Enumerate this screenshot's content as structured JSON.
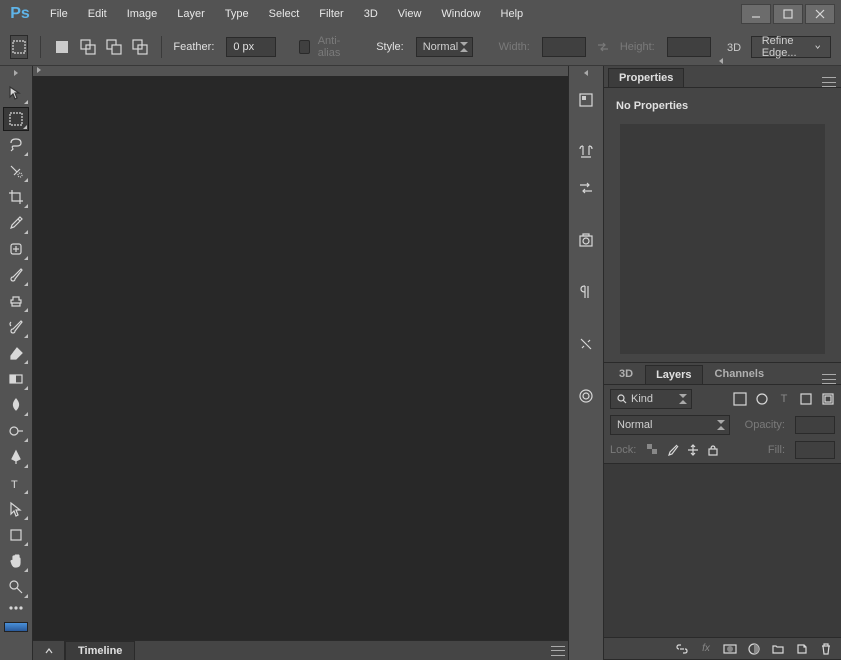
{
  "app": {
    "logo": "Ps"
  },
  "menu": [
    "File",
    "Edit",
    "Image",
    "Layer",
    "Type",
    "Select",
    "Filter",
    "3D",
    "View",
    "Window",
    "Help"
  ],
  "options": {
    "feather_label": "Feather:",
    "feather_value": "0 px",
    "antialias_label": "Anti-alias",
    "style_label": "Style:",
    "style_value": "Normal",
    "width_label": "Width:",
    "height_label": "Height:",
    "refine_label": "Refine Edge..."
  },
  "timeline": {
    "label": "Timeline"
  },
  "properties": {
    "tab": "Properties",
    "body": "No Properties"
  },
  "layers": {
    "tabs": [
      "3D",
      "Layers",
      "Channels"
    ],
    "kind": "Kind",
    "blend": "Normal",
    "opacity_label": "Opacity:",
    "lock_label": "Lock:",
    "fill_label": "Fill:"
  }
}
